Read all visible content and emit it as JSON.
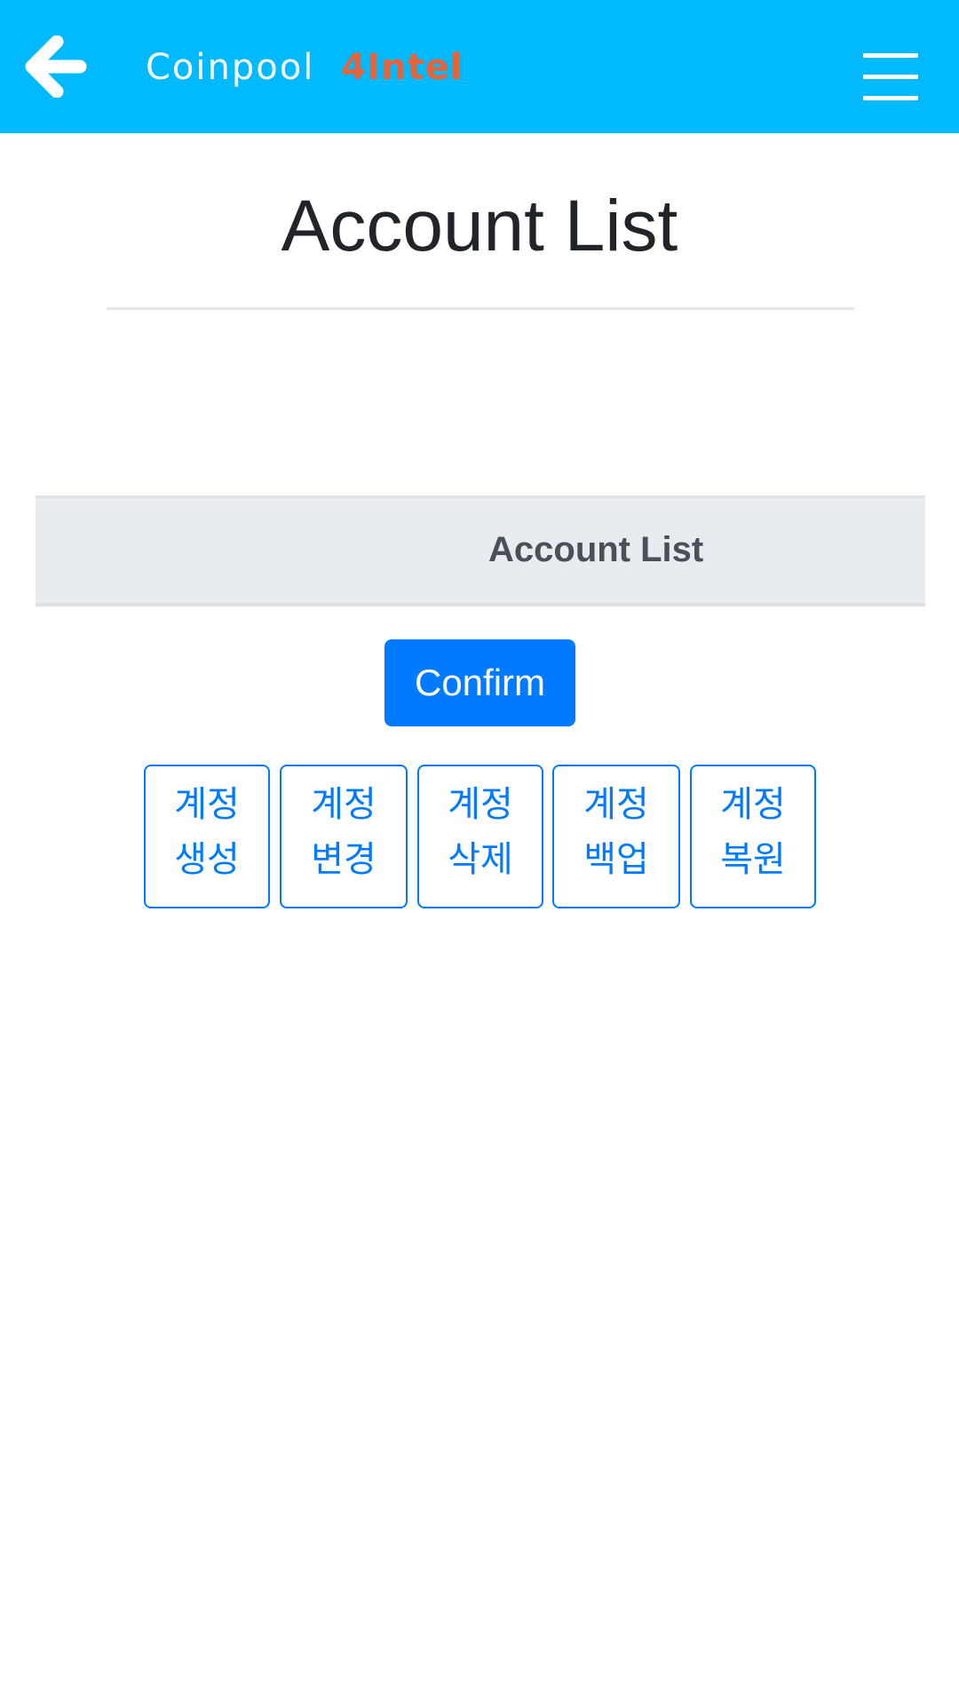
{
  "header": {
    "back_icon": "arrow-left-icon",
    "brand_name": "Coinpool",
    "brand_tag": "4Intel",
    "menu_icon": "hamburger-menu-icon",
    "background_color": "#00b9ff",
    "brand_tag_color": "#e8623a"
  },
  "main": {
    "title": "Account List",
    "list_header": "Account List",
    "confirm_label": "Confirm",
    "confirm_color": "#007bff"
  },
  "actions": [
    {
      "line1": "계정",
      "line2": "생성"
    },
    {
      "line1": "계정",
      "line2": "변경"
    },
    {
      "line1": "계정",
      "line2": "삭제"
    },
    {
      "line1": "계정",
      "line2": "백업"
    },
    {
      "line1": "계정",
      "line2": "복원"
    }
  ]
}
